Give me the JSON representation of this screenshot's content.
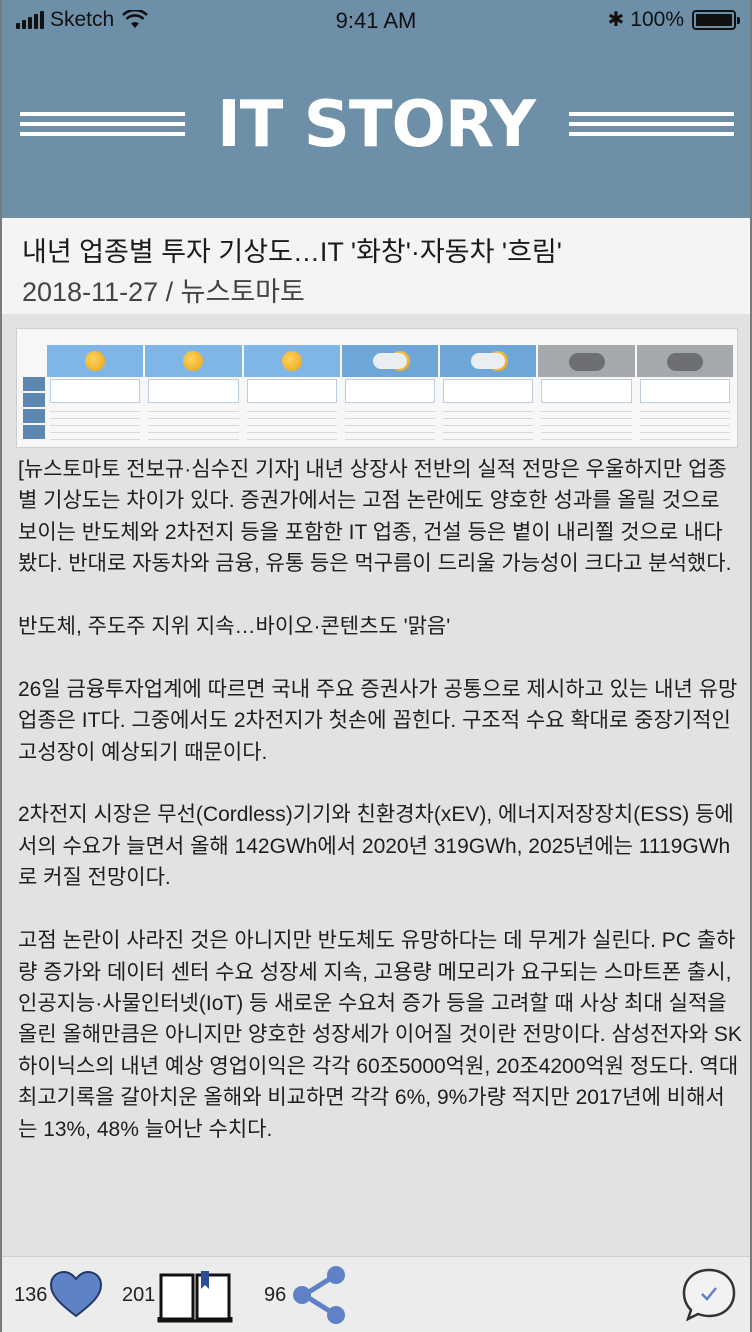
{
  "status_bar": {
    "carrier": "Sketch",
    "time": "9:41 AM",
    "battery": "100%"
  },
  "header": {
    "brand": "IT STORY",
    "colors": {
      "band": "#6e8fa8",
      "text": "#ffffff"
    }
  },
  "article": {
    "headline": "내년 업종별 투자 기상도…IT '화창'·자동차 '흐림'",
    "date": "2018-11-27",
    "source": "뉴스토마토",
    "body": "[뉴스토마토 전보규·심수진 기자] 내년 상장사 전반의 실적 전망은 우울하지만 업종별 기상도는 차이가 있다. 증권가에서는 고점 논란에도 양호한 성과를 올릴 것으로 보이는 반도체와 2차전지 등을 포함한 IT 업종, 건설 등은 볕이 내리쬘 것으로 내다봤다. 반대로 자동차와 금융, 유통 등은 먹구름이 드리울 가능성이 크다고 분석했다.\n\n반도체, 주도주 지위 지속…바이오·콘텐츠도 '맑음'\n\n26일 금융투자업계에 따르면 국내 주요 증권사가 공통으로 제시하고 있는 내년 유망업종은 IT다. 그중에서도 2차전지가 첫손에 꼽힌다. 구조적 수요 확대로 중장기적인 고성장이 예상되기 때문이다.\n\n2차전지 시장은 무선(Cordless)기기와 친환경차(xEV), 에너지저장장치(ESS) 등에서의 수요가 늘면서 올해 142GWh에서 2020년 319GWh, 2025년에는 1119GWh로 커질 전망이다.\n\n고점 논란이 사라진 것은 아니지만 반도체도 유망하다는 데 무게가 실린다. PC 출하량 증가와 데이터 센터 수요 성장세 지속, 고용량 메모리가 요구되는 스마트폰 출시, 인공지능·사물인터넷(IoT) 등 새로운 수요처 증가 등을 고려할 때 사상 최대 실적을 올린 올해만큼은 아니지만 양호한 성장세가 이어질 것이란 전망이다. 삼성전자와 SK하이닉스의 내년 예상 영업이익은 각각 60조5000억원, 20조4200억원 정도다. 역대 최고기록을 갈아치운 올해와 비교하면 각각 6%, 9%가량 적지만 2017년에 비해서는 13%, 48% 늘어난 수치다."
  },
  "actions": {
    "likes": "136",
    "bookmarks": "201",
    "shares": "96",
    "like_icon": "heart-icon",
    "bookmark_icon": "book-icon",
    "share_icon": "share-icon",
    "comment_icon": "comment-icon",
    "accent": "#5f82c6"
  }
}
